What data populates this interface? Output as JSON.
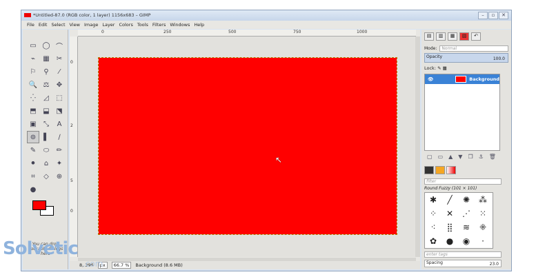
{
  "window": {
    "title": "*Untitled-87.0 (RGB color, 1 layer) 1156x683 – GIMP",
    "controls": [
      "–",
      "▫",
      "✕"
    ]
  },
  "menu": [
    "File",
    "Edit",
    "Select",
    "View",
    "Image",
    "Layer",
    "Colors",
    "Tools",
    "Filters",
    "Windows",
    "Help"
  ],
  "toolbox": {
    "tools": [
      "▭",
      "◯",
      "⌒",
      "⌁",
      "▦",
      "✂",
      "⚐",
      "⚲",
      "⁄",
      "🔍",
      "⚖",
      "✥",
      "⁛",
      "◿",
      "⬚",
      "⬒",
      "⬓",
      "⬔",
      "▣",
      "⤡",
      "A",
      "⊚",
      "▌",
      "∕",
      "✎",
      "⬭",
      "✏",
      "⚫",
      "⌂",
      "✦",
      "⌗",
      "◇",
      "⊕",
      "●"
    ],
    "drop_hint": "You can drop dockable dialogs here",
    "fg_color": "#ff0000",
    "bg_color": "#ffffff"
  },
  "ruler": {
    "h_ticks": [
      "0",
      "250",
      "500",
      "750",
      "1000"
    ],
    "v_ticks": [
      "0",
      "2",
      "5",
      "0"
    ]
  },
  "status": {
    "coords": "8, 396",
    "unit": "px",
    "zoom": "66.7 %",
    "layer_info": "Background (8.6 MB)"
  },
  "layers_panel": {
    "mode_label": "Mode:",
    "mode_value": "Normal",
    "opacity_label": "Opacity",
    "opacity_value": "100.0",
    "lock_label": "Lock:",
    "layer_name": "Background"
  },
  "brushes_panel": {
    "filter_placeholder": "filter",
    "brush_name": "Round Fuzzy (101 × 101)",
    "tags_placeholder": "enter tags",
    "spacing_label": "Spacing",
    "spacing_value": "23.0"
  },
  "watermark": {
    "main": "Solvetic",
    "sub": ".com"
  }
}
